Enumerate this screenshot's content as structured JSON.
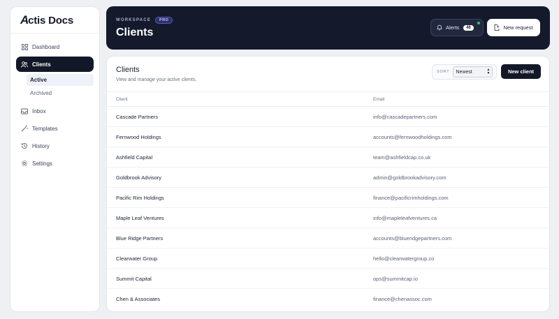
{
  "brand": {
    "mark": "A",
    "name": "ctis Docs"
  },
  "sidebar": {
    "items": [
      {
        "label": "Dashboard",
        "icon": "grid-icon"
      },
      {
        "label": "Clients",
        "icon": "users-icon",
        "active": true
      },
      {
        "label": "Inbox",
        "icon": "inbox-icon"
      },
      {
        "label": "Templates",
        "icon": "wand-icon"
      },
      {
        "label": "History",
        "icon": "history-icon"
      },
      {
        "label": "Settings",
        "icon": "gear-icon"
      }
    ],
    "subitems": [
      {
        "label": "Active",
        "active": true
      },
      {
        "label": "Archived"
      }
    ]
  },
  "header": {
    "workspace_label": "WORKSPACE",
    "badge": "PRO",
    "title": "Clients",
    "alerts_label": "Alerts",
    "alerts_count": "46",
    "new_request_label": "New request"
  },
  "card": {
    "title": "Clients",
    "subtitle": "View and manage your active clients.",
    "sort_label": "SORT",
    "sort_value": "Newest",
    "new_client_label": "New client",
    "columns": {
      "client": "Client",
      "email": "Email"
    },
    "rows": [
      {
        "client": "Cascade Partners",
        "email": "info@cascadepartners.com"
      },
      {
        "client": "Fernwood Holdings",
        "email": "accounts@fernwoodholdings.com"
      },
      {
        "client": "Ashfield Capital",
        "email": "team@ashfieldcap.co.uk"
      },
      {
        "client": "Goldbrook Advisory",
        "email": "admin@goldbrookadvisory.com"
      },
      {
        "client": "Pacific Rim Holdings",
        "email": "finance@pacificrimholdings.com"
      },
      {
        "client": "Maple Leaf Ventures",
        "email": "info@mapleleafventures.ca"
      },
      {
        "client": "Blue Ridge Partners",
        "email": "accounts@blueridgepartners.com"
      },
      {
        "client": "Clearwater Group",
        "email": "hello@clearwatergroup.co"
      },
      {
        "client": "Summit Capital",
        "email": "ops@summitcap.io"
      },
      {
        "client": "Chen & Associates",
        "email": "finance@chenassoc.com"
      }
    ]
  },
  "colors": {
    "dark": "#141a2c",
    "accent_badge": "#2b2f6a",
    "status_dot": "#33c27a"
  }
}
